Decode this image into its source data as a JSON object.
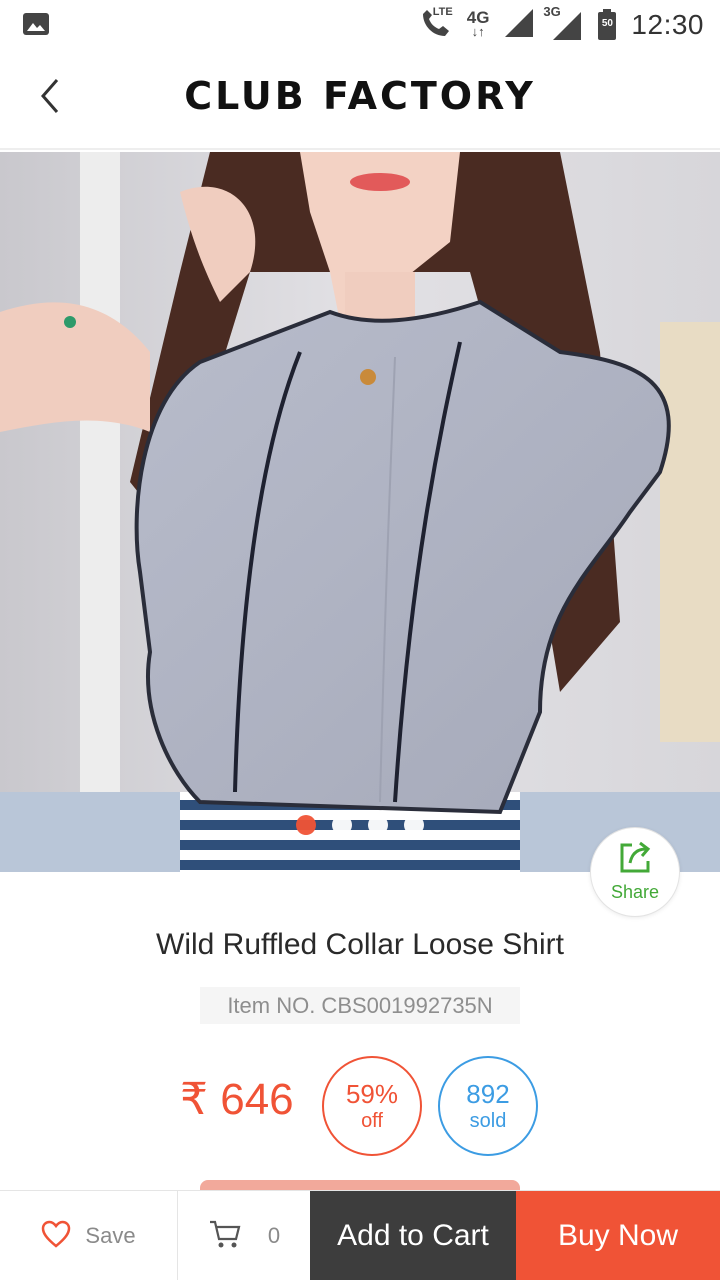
{
  "status_bar": {
    "network_lte": "LTE",
    "network_4g": "4G",
    "network_3g": "3G",
    "battery": "50",
    "time": "12:30"
  },
  "header": {
    "brand": "CLUB FACTORY"
  },
  "gallery": {
    "image_count": 4,
    "active_index": 0
  },
  "share": {
    "label": "Share"
  },
  "product": {
    "title": "Wild Ruffled Collar Loose Shirt",
    "item_no": "Item NO. CBS001992735N",
    "price": "₹ 646",
    "discount_value": "59%",
    "discount_label": "off",
    "sold_value": "892",
    "sold_label": "sold"
  },
  "bottom_bar": {
    "save_label": "Save",
    "cart_count": "0",
    "add_to_cart_label": "Add to Cart",
    "buy_now_label": "Buy Now"
  },
  "colors": {
    "accent": "#f05336",
    "sold_blue": "#3c9ce3",
    "share_green": "#43a938",
    "dark_button": "#3d3d3d"
  }
}
